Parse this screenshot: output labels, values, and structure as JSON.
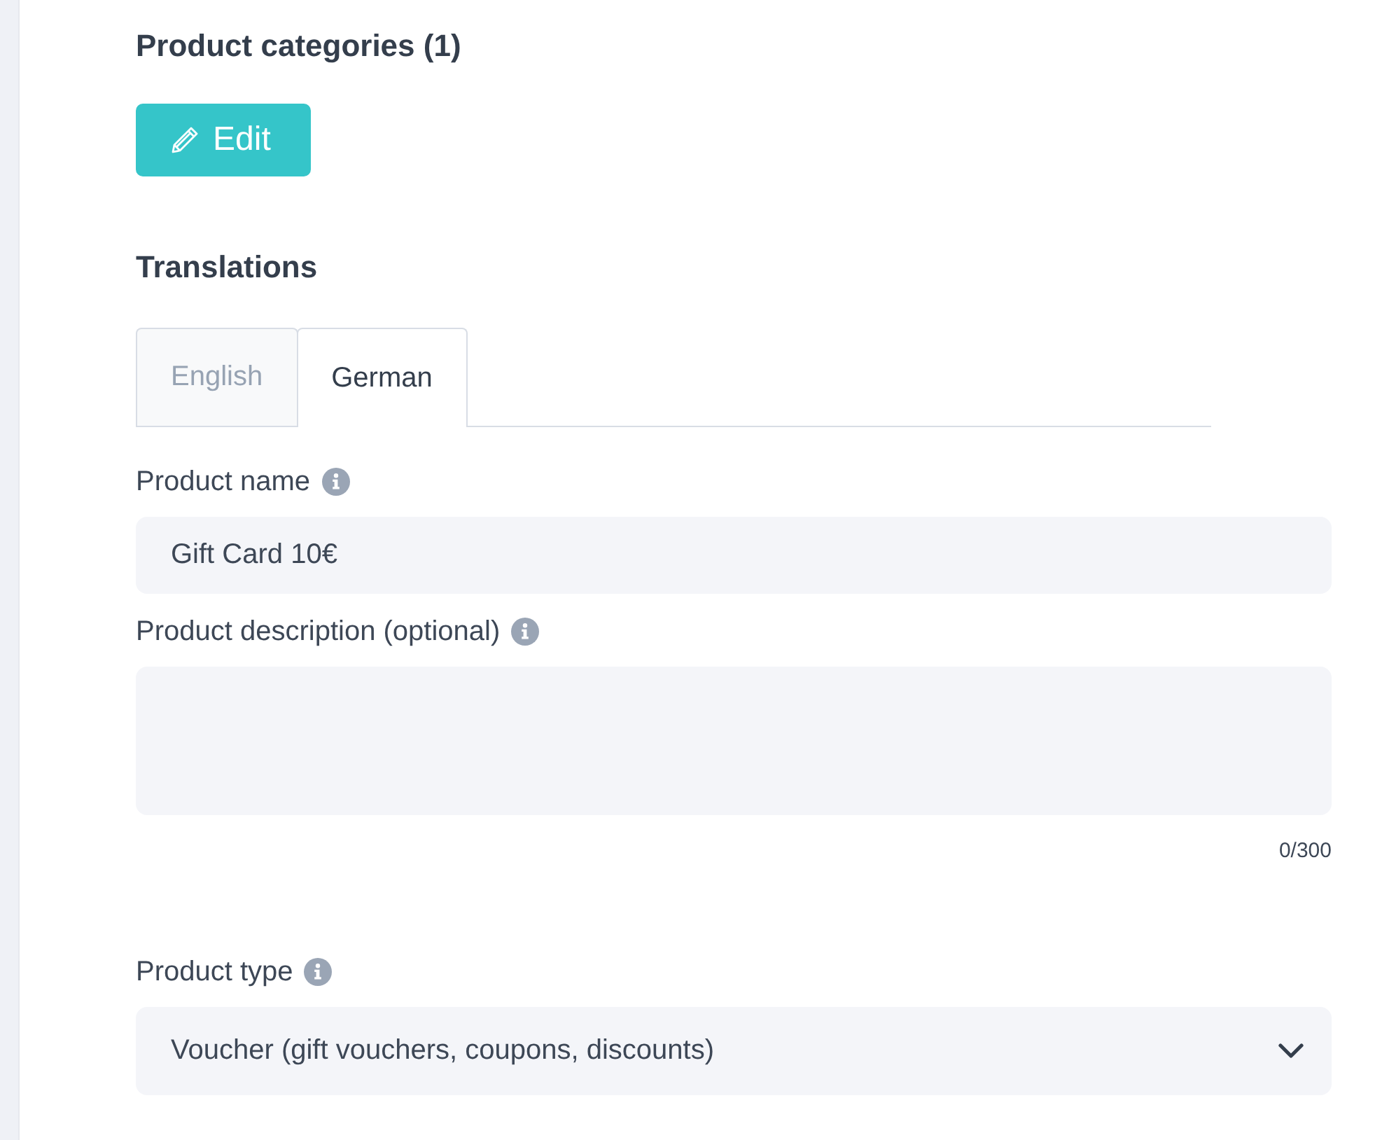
{
  "categories": {
    "title": "Product categories (1)",
    "edit_button": "Edit"
  },
  "translations": {
    "title": "Translations",
    "tabs": [
      {
        "label": "English",
        "selected": false
      },
      {
        "label": "German",
        "selected": true
      }
    ]
  },
  "fields": [
    {
      "kind": "input",
      "label": "Product name",
      "value": "Gift Card 10€"
    },
    {
      "kind": "textarea",
      "label": "Product description (optional)",
      "counter": "0/300"
    },
    {
      "kind": "select",
      "label": "Product type",
      "value": "Voucher (gift vouchers, coupons, discounts)"
    }
  ]
}
